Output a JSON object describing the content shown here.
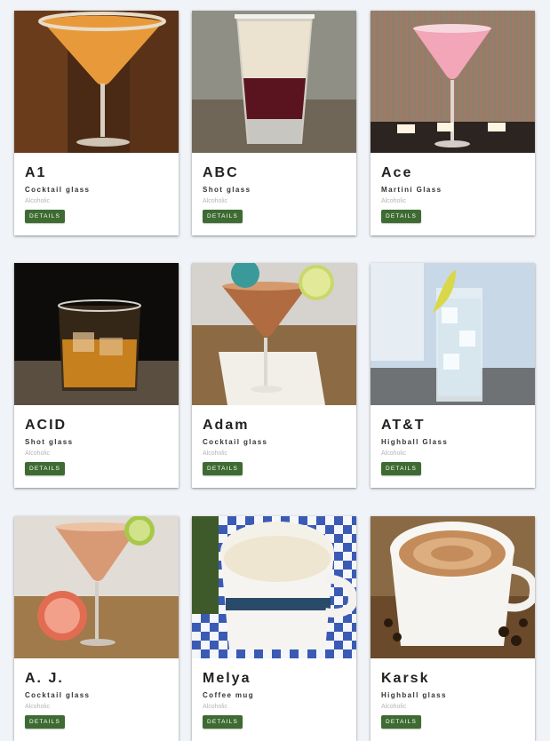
{
  "cards": [
    {
      "name": "A1",
      "glass": "Cocktail glass",
      "category": "Alcoholic",
      "button": "DETAILS"
    },
    {
      "name": "ABC",
      "glass": "Shot glass",
      "category": "Alcoholic",
      "button": "DETAILS"
    },
    {
      "name": "Ace",
      "glass": "Martini Glass",
      "category": "Alcoholic",
      "button": "DETAILS"
    },
    {
      "name": "ACID",
      "glass": "Shot glass",
      "category": "Alcoholic",
      "button": "DETAILS"
    },
    {
      "name": "Adam",
      "glass": "Cocktail glass",
      "category": "Alcoholic",
      "button": "DETAILS"
    },
    {
      "name": "AT&T",
      "glass": "Highball Glass",
      "category": "Alcoholic",
      "button": "DETAILS"
    },
    {
      "name": "A. J.",
      "glass": "Cocktail glass",
      "category": "Alcoholic",
      "button": "DETAILS"
    },
    {
      "name": "Melya",
      "glass": "Coffee mug",
      "category": "Alcoholic",
      "button": "DETAILS"
    },
    {
      "name": "Karsk",
      "glass": "Highball glass",
      "category": "Alcoholic",
      "button": "DETAILS"
    }
  ],
  "colors": {
    "page_background": "#f0f3f7",
    "button_green": "#3e6b32"
  }
}
